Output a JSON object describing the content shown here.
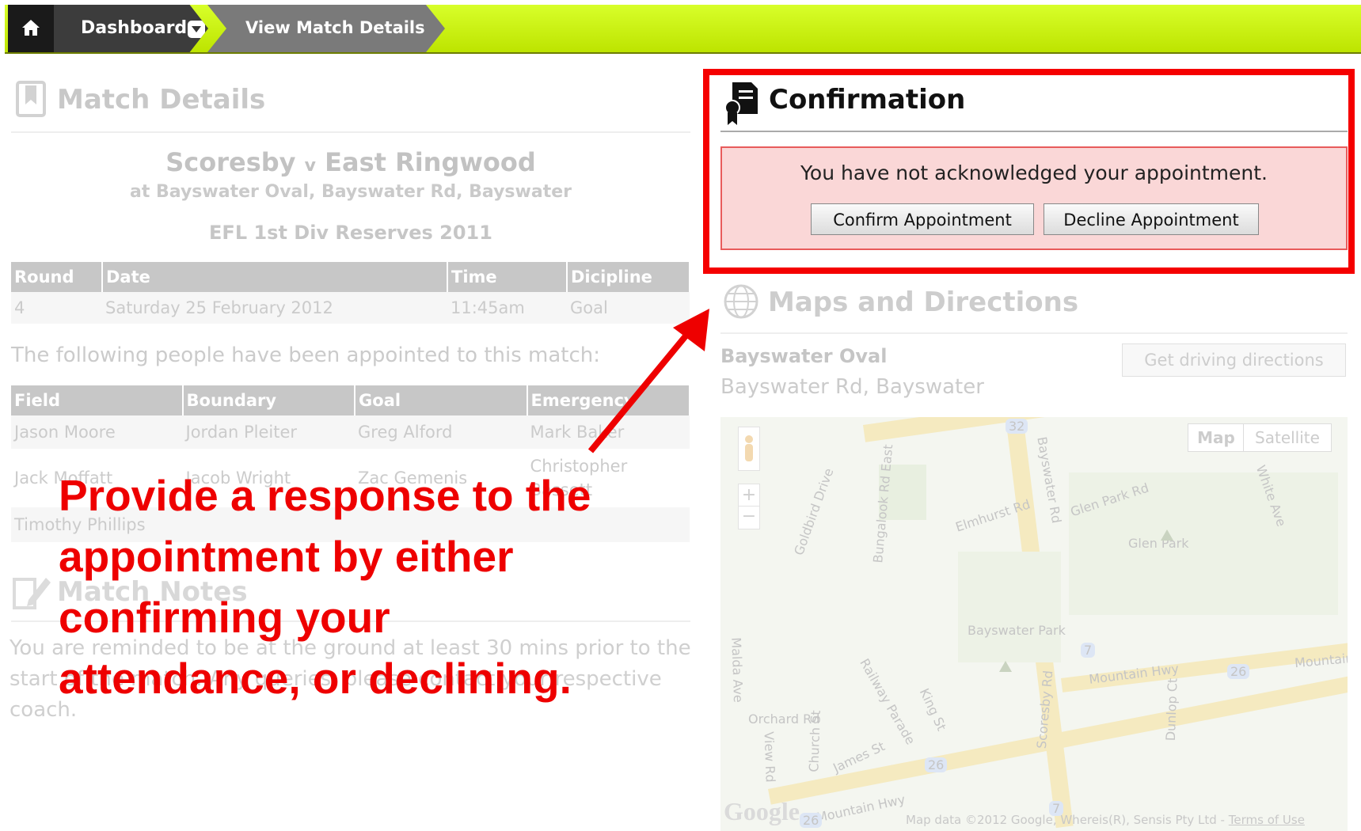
{
  "nav": {
    "dashboard": "Dashboard",
    "view_match": "View Match Details"
  },
  "match_details": {
    "title": "Match Details",
    "teams": "Scoresby",
    "vs": "v",
    "away": "East Ringwood",
    "venue": "at Bayswater Oval, Bayswater Rd, Bayswater",
    "competition": "EFL 1st Div Reserves 2011",
    "table1": {
      "headers": [
        "Round",
        "Date",
        "Time",
        "Dicipline"
      ],
      "row": [
        "4",
        "Saturday 25 February 2012",
        "11:45am",
        "Goal"
      ]
    },
    "appointed_text": "The following people have been appointed to this match:",
    "table2": {
      "headers": [
        "Field",
        "Boundary",
        "Goal",
        "Emergency"
      ],
      "rows": [
        [
          "Jason Moore",
          "Jordan Pleiter",
          "Greg Alford",
          "Mark Baker"
        ],
        [
          "Jack Moffatt",
          "Jacob Wright",
          "Zac Gemenis",
          "Christopher Bassett"
        ],
        [
          "Timothy Phillips",
          "",
          "",
          ""
        ]
      ]
    }
  },
  "match_notes": {
    "title": "Match Notes",
    "text": "You are reminded to be at the ground at least 30 mins prior to the start of the match. Any queries, please contact your respective coach."
  },
  "confirmation": {
    "title": "Confirmation",
    "message": "You have not acknowledged your appointment.",
    "confirm_label": "Confirm Appointment",
    "decline_label": "Decline Appointment"
  },
  "maps": {
    "title": "Maps and Directions",
    "place": "Bayswater Oval",
    "address": "Bayswater Rd, Bayswater",
    "directions_label": "Get driving directions",
    "map_tab": "Map",
    "satellite_tab": "Satellite",
    "labels": [
      "Bayswater Rd",
      "Bungalook Rd East",
      "Goldbird Drive",
      "Elmhurst Rd",
      "Glen Park Rd",
      "Glen Park",
      "White Ave",
      "Bayswater Park",
      "Mountain Hwy",
      "Mountain",
      "Orchard Rd",
      "Railway Parade",
      "King St",
      "James St",
      "Church St",
      "View Rd",
      "Scoresby Rd",
      "Dunlop Ct",
      "Malda Ave",
      "Mountain Hwy"
    ],
    "shields": [
      "32",
      "7",
      "26",
      "26",
      "7",
      "26"
    ],
    "attribution": "Map data ©2012 Google, Whereis(R), Sensis Pty Ltd -",
    "terms": "Terms of Use",
    "logo": "Google"
  },
  "annotation": "Provide a response to the appointment by either confirming your attendance, or declining.",
  "colors": {
    "nav": "#c6ef00",
    "highlight": "#f50000",
    "alert_bg": "#fad7d7"
  }
}
